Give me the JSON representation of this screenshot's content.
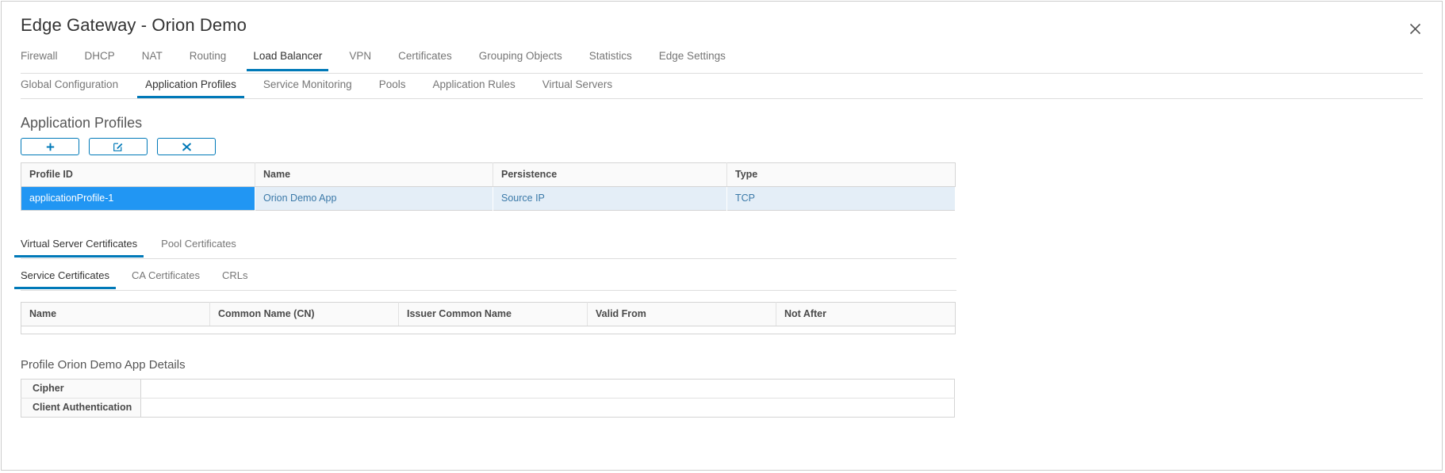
{
  "window": {
    "title": "Edge Gateway - Orion Demo",
    "close_icon": "close-icon"
  },
  "primary_tabs": [
    {
      "label": "Firewall",
      "active": false
    },
    {
      "label": "DHCP",
      "active": false
    },
    {
      "label": "NAT",
      "active": false
    },
    {
      "label": "Routing",
      "active": false
    },
    {
      "label": "Load Balancer",
      "active": true
    },
    {
      "label": "VPN",
      "active": false
    },
    {
      "label": "Certificates",
      "active": false
    },
    {
      "label": "Grouping Objects",
      "active": false
    },
    {
      "label": "Statistics",
      "active": false
    },
    {
      "label": "Edge Settings",
      "active": false
    }
  ],
  "secondary_tabs": [
    {
      "label": "Global Configuration",
      "active": false
    },
    {
      "label": "Application Profiles",
      "active": true
    },
    {
      "label": "Service Monitoring",
      "active": false
    },
    {
      "label": "Pools",
      "active": false
    },
    {
      "label": "Application Rules",
      "active": false
    },
    {
      "label": "Virtual Servers",
      "active": false
    }
  ],
  "app_profiles": {
    "heading": "Application Profiles",
    "toolbar": [
      {
        "name": "add-profile-button",
        "icon": "plus-icon"
      },
      {
        "name": "edit-profile-button",
        "icon": "edit-pencil-icon"
      },
      {
        "name": "delete-profile-button",
        "icon": "delete-x-icon"
      }
    ],
    "columns": [
      "Profile ID",
      "Name",
      "Persistence",
      "Type"
    ],
    "rows": [
      {
        "selected": true,
        "cells": [
          "applicationProfile-1",
          "Orion Demo App",
          "Source IP",
          "TCP"
        ]
      }
    ]
  },
  "certificates": {
    "tabs": [
      {
        "label": "Virtual Server Certificates",
        "active": true
      },
      {
        "label": "Pool Certificates",
        "active": false
      }
    ],
    "subtabs": [
      {
        "label": "Service Certificates",
        "active": true
      },
      {
        "label": "CA Certificates",
        "active": false
      },
      {
        "label": "CRLs",
        "active": false
      }
    ],
    "columns": [
      "Name",
      "Common Name (CN)",
      "Issuer Common Name",
      "Valid From",
      "Not After"
    ],
    "rows": []
  },
  "profile_details": {
    "heading": "Profile Orion Demo App Details",
    "rows": [
      {
        "label": "Cipher",
        "value": ""
      },
      {
        "label": "Client Authentication",
        "value": ""
      }
    ]
  },
  "colors": {
    "accent": "#0079b8",
    "selection": "#2196f3",
    "selection_row": "#e4eef7",
    "header_bg": "#fafafa",
    "border": "#d4d4d4"
  }
}
